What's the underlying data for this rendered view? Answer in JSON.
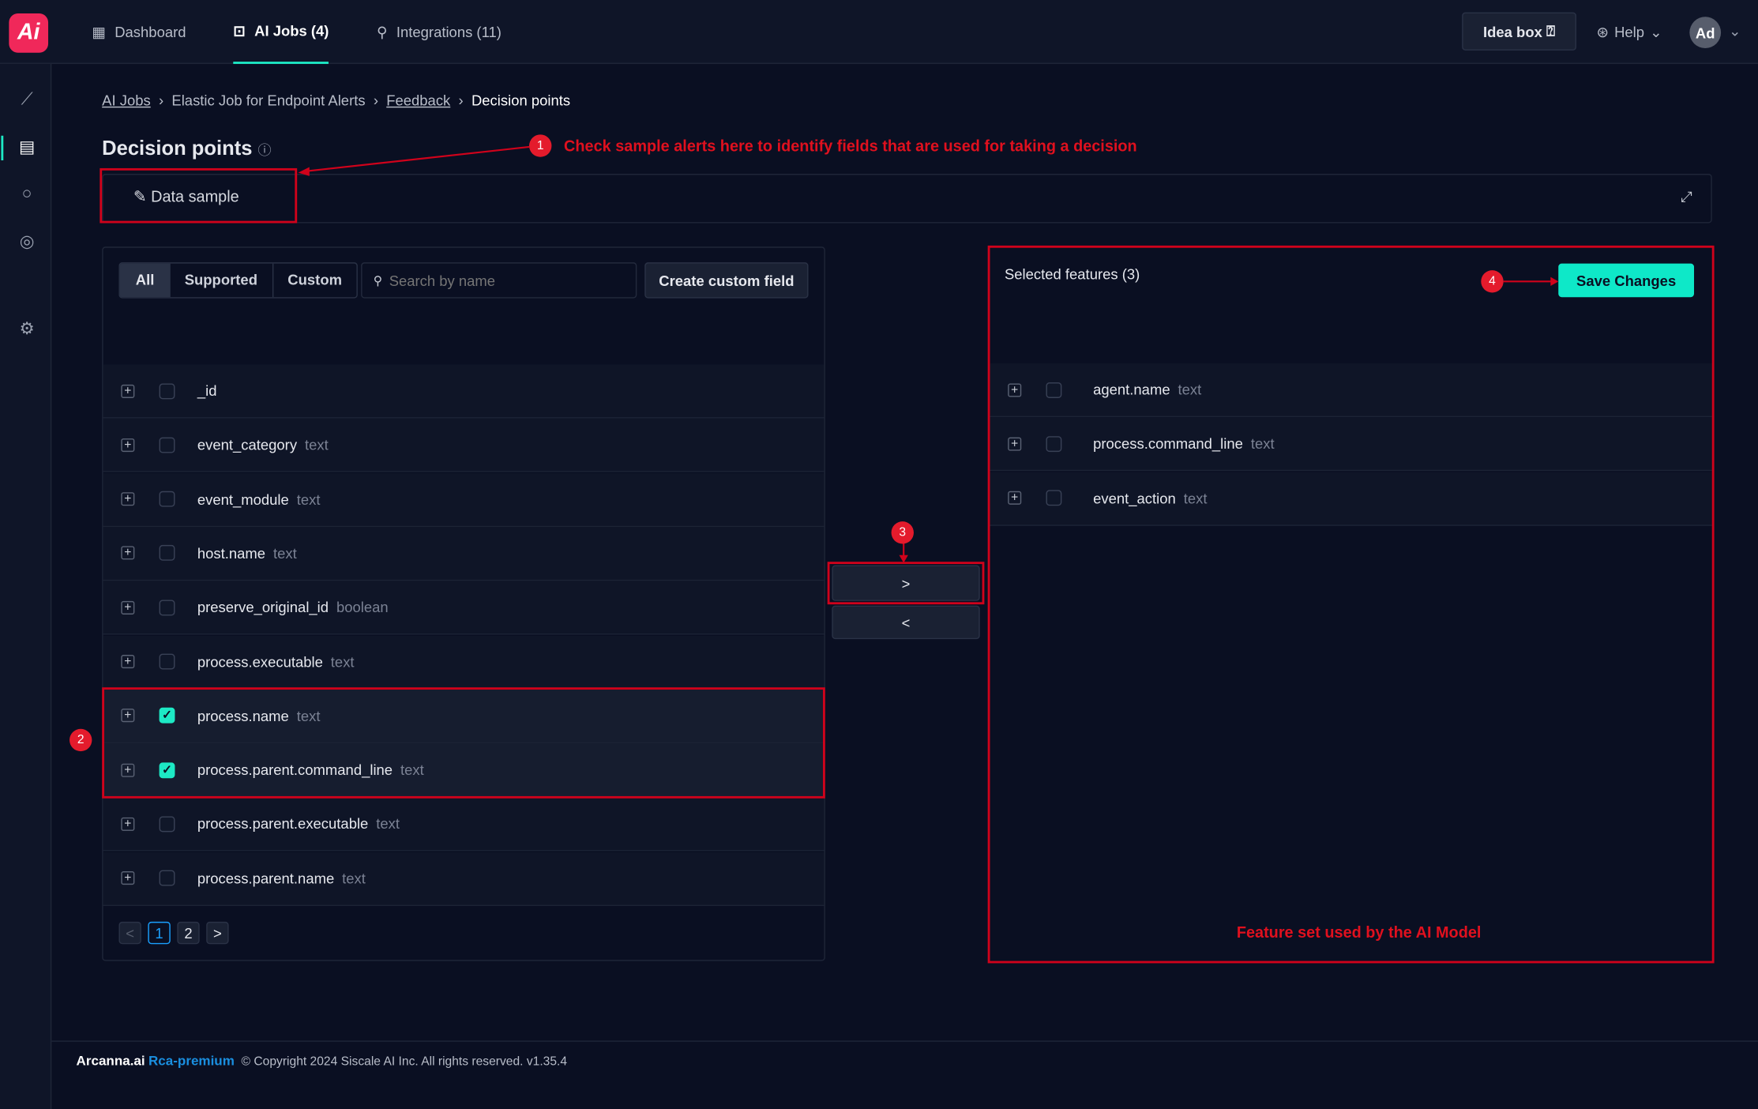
{
  "app": {
    "logo": "Ai",
    "brand_color": "#f0285a",
    "accent": "#1de9c5"
  },
  "topnav": {
    "items": [
      {
        "label": "Dashboard",
        "icon": "grid-icon"
      },
      {
        "label": "AI Jobs (4)",
        "icon": "chip-icon",
        "active": true
      },
      {
        "label": "Integrations (11)",
        "icon": "plug-icon"
      }
    ],
    "idea_box": "Idea box",
    "help": "Help",
    "avatar": "Ad"
  },
  "sidebar": {
    "items": [
      "chart-icon",
      "feedback-icon",
      "search-icon",
      "target-icon",
      "gear-icon"
    ]
  },
  "breadcrumb": [
    {
      "label": "AI Jobs",
      "link": true
    },
    {
      "label": "Elastic Job for Endpoint Alerts",
      "link": false
    },
    {
      "label": "Feedback",
      "link": true
    },
    {
      "label": "Decision points",
      "link": false
    }
  ],
  "page": {
    "title": "Decision points",
    "data_sample": "Data sample"
  },
  "left": {
    "filters": [
      "All",
      "Supported",
      "Custom"
    ],
    "active_filter": "All",
    "search_placeholder": "Search by name",
    "create_button": "Create custom field",
    "rows": [
      {
        "name": "_id",
        "type": "",
        "checked": false
      },
      {
        "name": "event_category",
        "type": "text",
        "checked": false
      },
      {
        "name": "event_module",
        "type": "text",
        "checked": false
      },
      {
        "name": "host.name",
        "type": "text",
        "checked": false
      },
      {
        "name": "preserve_original_id",
        "type": "boolean",
        "checked": false
      },
      {
        "name": "process.executable",
        "type": "text",
        "checked": false
      },
      {
        "name": "process.name",
        "type": "text",
        "checked": true
      },
      {
        "name": "process.parent.command_line",
        "type": "text",
        "checked": true
      },
      {
        "name": "process.parent.executable",
        "type": "text",
        "checked": false
      },
      {
        "name": "process.parent.name",
        "type": "text",
        "checked": false
      }
    ],
    "pagination": {
      "prev": "<",
      "pages": [
        "1",
        "2"
      ],
      "current": "1",
      "next": ">"
    }
  },
  "transfer": {
    "right": ">",
    "left": "<"
  },
  "right": {
    "title": "Selected features (3)",
    "save": "Save Changes",
    "rows": [
      {
        "name": "agent.name",
        "type": "text"
      },
      {
        "name": "process.command_line",
        "type": "text"
      },
      {
        "name": "event_action",
        "type": "text"
      }
    ]
  },
  "annotations": {
    "a1": "1",
    "t1": "Check sample alerts here to identify fields that are used for taking a decision",
    "a2": "2",
    "a3": "3",
    "a4": "4",
    "t5": "Feature set used by the AI Model"
  },
  "footer": {
    "brand": "Arcanna.ai",
    "edition": "Rca-premium",
    "copyright": "© Copyright 2024 Siscale AI Inc. All rights reserved. v1.35.4"
  }
}
